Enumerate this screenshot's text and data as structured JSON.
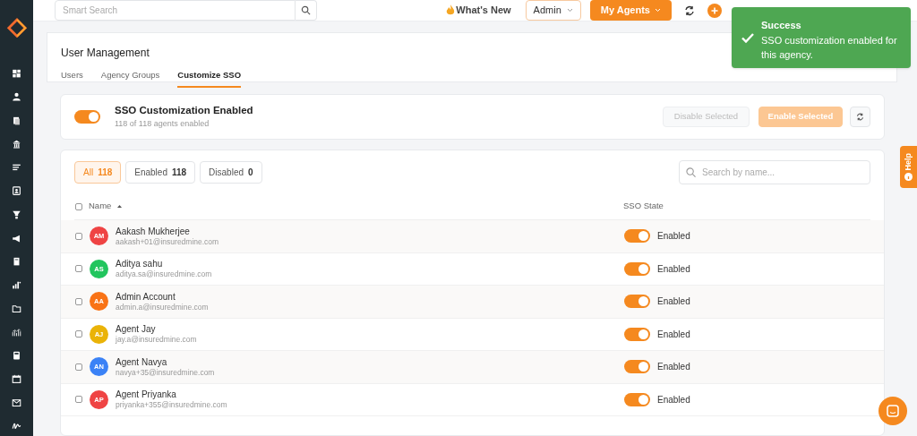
{
  "top_bar": {
    "search_placeholder": "Smart Search",
    "whats_new": "What's New",
    "role_select": "Admin",
    "agents_button": "My Agents"
  },
  "toast": {
    "title": "Success",
    "message": "SSO customization enabled for this agency."
  },
  "page": {
    "title": "User Management",
    "tabs": [
      {
        "label": "Users",
        "selected": false
      },
      {
        "label": "Agency Groups",
        "selected": false
      },
      {
        "label": "Customize SSO",
        "selected": true
      }
    ]
  },
  "sso_card": {
    "title": "SSO Customization Enabled",
    "subtitle": "118 of 118 agents enabled",
    "on": true,
    "buttons": [
      {
        "label": "Disable Selected",
        "kind": "secondary",
        "disabled": true
      },
      {
        "label": "Enable Selected",
        "kind": "primary",
        "disabled": true
      }
    ]
  },
  "filters": [
    {
      "label": "All",
      "count": "118",
      "selected": true
    },
    {
      "label": "Enabled",
      "count": "118",
      "selected": false
    },
    {
      "label": "Disabled",
      "count": "0",
      "selected": false
    }
  ],
  "search": {
    "placeholder": "Search by name..."
  },
  "table": {
    "all_checked": false,
    "columns": [
      "Name",
      "SSO State"
    ],
    "rows": [
      {
        "initials": "AM",
        "color": "#ef4444",
        "name": "Aakash Mukherjee",
        "email": "aakash+01@insuredmine.com",
        "checked": false,
        "on": true,
        "state": "Enabled"
      },
      {
        "initials": "AS",
        "color": "#22c55e",
        "name": "Aditya sahu",
        "email": "aditya.sa@insuredmine.com",
        "checked": false,
        "on": true,
        "state": "Enabled"
      },
      {
        "initials": "AA",
        "color": "#f97316",
        "name": "Admin Account",
        "email": "admin.a@insuredmine.com",
        "checked": false,
        "on": true,
        "state": "Enabled"
      },
      {
        "initials": "AJ",
        "color": "#eab308",
        "name": "Agent Jay",
        "email": "jay.a@insuredmine.com",
        "checked": false,
        "on": true,
        "state": "Enabled"
      },
      {
        "initials": "AN",
        "color": "#3b82f6",
        "name": "Agent Navya",
        "email": "navya+35@insuredmine.com",
        "checked": false,
        "on": true,
        "state": "Enabled"
      },
      {
        "initials": "AP",
        "color": "#ef4444",
        "name": "Agent Priyanka",
        "email": "priyanka+355@insuredmine.com",
        "checked": false,
        "on": true,
        "state": "Enabled"
      }
    ]
  },
  "help_tab": "Help"
}
